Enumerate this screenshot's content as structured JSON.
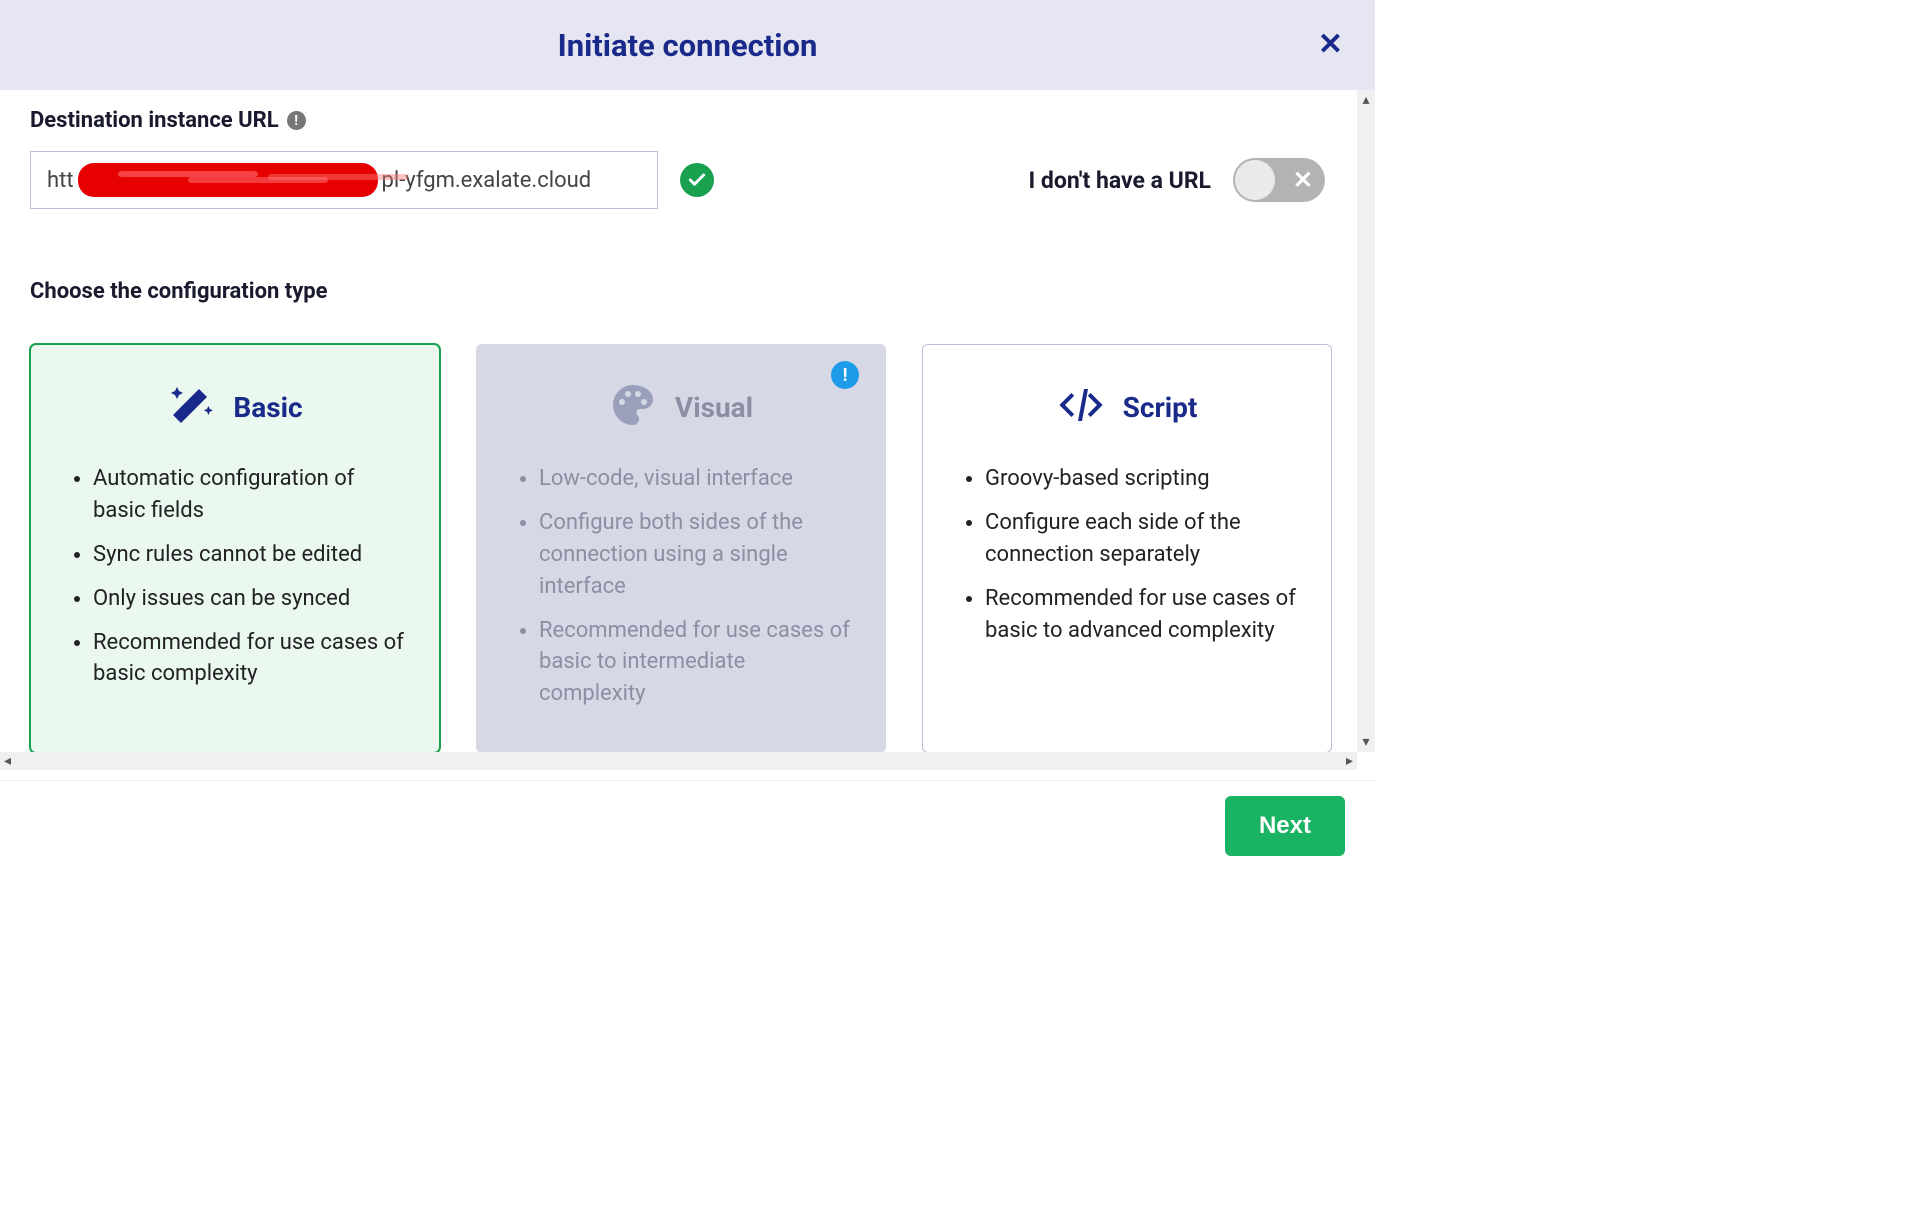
{
  "modal": {
    "title": "Initiate connection",
    "close_label": "✕"
  },
  "url_section": {
    "label": "Destination instance URL",
    "input_prefix": "htt",
    "input_suffix": "pl-yfgm.exalate.cloud",
    "validated": true,
    "no_url_label": "I don't have a URL",
    "no_url_toggle_on": false
  },
  "config_section": {
    "label": "Choose the configuration type",
    "cards": [
      {
        "key": "basic",
        "title": "Basic",
        "icon": "wand-icon",
        "selected": true,
        "disabled": false,
        "bullets": [
          "Automatic configuration of basic fields",
          "Sync rules cannot be edited",
          "Only issues can be synced",
          "Recommended for use cases of basic complexity"
        ]
      },
      {
        "key": "visual",
        "title": "Visual",
        "icon": "palette-icon",
        "selected": false,
        "disabled": true,
        "info_badge": true,
        "bullets": [
          "Low-code, visual interface",
          "Configure both sides of the connection using a single interface",
          "Recommended for use cases of basic to intermediate complexity"
        ]
      },
      {
        "key": "script",
        "title": "Script",
        "icon": "code-icon",
        "selected": false,
        "disabled": false,
        "bullets": [
          "Groovy-based scripting",
          "Configure each side of the connection separately",
          "Recommended for use cases of basic to advanced complexity"
        ]
      }
    ]
  },
  "footer": {
    "next_label": "Next"
  }
}
